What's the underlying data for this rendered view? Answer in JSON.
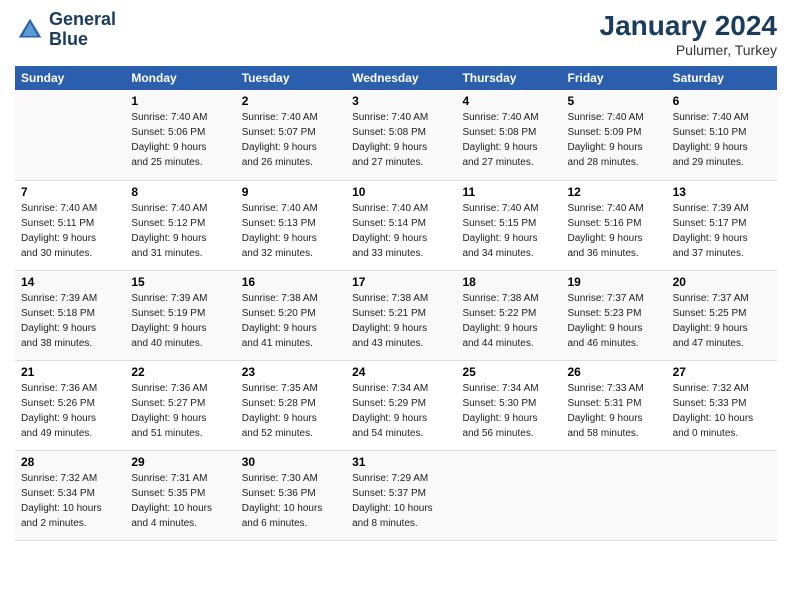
{
  "header": {
    "logo_line1": "General",
    "logo_line2": "Blue",
    "title": "January 2024",
    "subtitle": "Pulumer, Turkey"
  },
  "columns": [
    "Sunday",
    "Monday",
    "Tuesday",
    "Wednesday",
    "Thursday",
    "Friday",
    "Saturday"
  ],
  "weeks": [
    {
      "cells": [
        {
          "day": "",
          "info": ""
        },
        {
          "day": "1",
          "info": "Sunrise: 7:40 AM\nSunset: 5:06 PM\nDaylight: 9 hours\nand 25 minutes."
        },
        {
          "day": "2",
          "info": "Sunrise: 7:40 AM\nSunset: 5:07 PM\nDaylight: 9 hours\nand 26 minutes."
        },
        {
          "day": "3",
          "info": "Sunrise: 7:40 AM\nSunset: 5:08 PM\nDaylight: 9 hours\nand 27 minutes."
        },
        {
          "day": "4",
          "info": "Sunrise: 7:40 AM\nSunset: 5:08 PM\nDaylight: 9 hours\nand 27 minutes."
        },
        {
          "day": "5",
          "info": "Sunrise: 7:40 AM\nSunset: 5:09 PM\nDaylight: 9 hours\nand 28 minutes."
        },
        {
          "day": "6",
          "info": "Sunrise: 7:40 AM\nSunset: 5:10 PM\nDaylight: 9 hours\nand 29 minutes."
        }
      ]
    },
    {
      "cells": [
        {
          "day": "7",
          "info": "Sunrise: 7:40 AM\nSunset: 5:11 PM\nDaylight: 9 hours\nand 30 minutes."
        },
        {
          "day": "8",
          "info": "Sunrise: 7:40 AM\nSunset: 5:12 PM\nDaylight: 9 hours\nand 31 minutes."
        },
        {
          "day": "9",
          "info": "Sunrise: 7:40 AM\nSunset: 5:13 PM\nDaylight: 9 hours\nand 32 minutes."
        },
        {
          "day": "10",
          "info": "Sunrise: 7:40 AM\nSunset: 5:14 PM\nDaylight: 9 hours\nand 33 minutes."
        },
        {
          "day": "11",
          "info": "Sunrise: 7:40 AM\nSunset: 5:15 PM\nDaylight: 9 hours\nand 34 minutes."
        },
        {
          "day": "12",
          "info": "Sunrise: 7:40 AM\nSunset: 5:16 PM\nDaylight: 9 hours\nand 36 minutes."
        },
        {
          "day": "13",
          "info": "Sunrise: 7:39 AM\nSunset: 5:17 PM\nDaylight: 9 hours\nand 37 minutes."
        }
      ]
    },
    {
      "cells": [
        {
          "day": "14",
          "info": "Sunrise: 7:39 AM\nSunset: 5:18 PM\nDaylight: 9 hours\nand 38 minutes."
        },
        {
          "day": "15",
          "info": "Sunrise: 7:39 AM\nSunset: 5:19 PM\nDaylight: 9 hours\nand 40 minutes."
        },
        {
          "day": "16",
          "info": "Sunrise: 7:38 AM\nSunset: 5:20 PM\nDaylight: 9 hours\nand 41 minutes."
        },
        {
          "day": "17",
          "info": "Sunrise: 7:38 AM\nSunset: 5:21 PM\nDaylight: 9 hours\nand 43 minutes."
        },
        {
          "day": "18",
          "info": "Sunrise: 7:38 AM\nSunset: 5:22 PM\nDaylight: 9 hours\nand 44 minutes."
        },
        {
          "day": "19",
          "info": "Sunrise: 7:37 AM\nSunset: 5:23 PM\nDaylight: 9 hours\nand 46 minutes."
        },
        {
          "day": "20",
          "info": "Sunrise: 7:37 AM\nSunset: 5:25 PM\nDaylight: 9 hours\nand 47 minutes."
        }
      ]
    },
    {
      "cells": [
        {
          "day": "21",
          "info": "Sunrise: 7:36 AM\nSunset: 5:26 PM\nDaylight: 9 hours\nand 49 minutes."
        },
        {
          "day": "22",
          "info": "Sunrise: 7:36 AM\nSunset: 5:27 PM\nDaylight: 9 hours\nand 51 minutes."
        },
        {
          "day": "23",
          "info": "Sunrise: 7:35 AM\nSunset: 5:28 PM\nDaylight: 9 hours\nand 52 minutes."
        },
        {
          "day": "24",
          "info": "Sunrise: 7:34 AM\nSunset: 5:29 PM\nDaylight: 9 hours\nand 54 minutes."
        },
        {
          "day": "25",
          "info": "Sunrise: 7:34 AM\nSunset: 5:30 PM\nDaylight: 9 hours\nand 56 minutes."
        },
        {
          "day": "26",
          "info": "Sunrise: 7:33 AM\nSunset: 5:31 PM\nDaylight: 9 hours\nand 58 minutes."
        },
        {
          "day": "27",
          "info": "Sunrise: 7:32 AM\nSunset: 5:33 PM\nDaylight: 10 hours\nand 0 minutes."
        }
      ]
    },
    {
      "cells": [
        {
          "day": "28",
          "info": "Sunrise: 7:32 AM\nSunset: 5:34 PM\nDaylight: 10 hours\nand 2 minutes."
        },
        {
          "day": "29",
          "info": "Sunrise: 7:31 AM\nSunset: 5:35 PM\nDaylight: 10 hours\nand 4 minutes."
        },
        {
          "day": "30",
          "info": "Sunrise: 7:30 AM\nSunset: 5:36 PM\nDaylight: 10 hours\nand 6 minutes."
        },
        {
          "day": "31",
          "info": "Sunrise: 7:29 AM\nSunset: 5:37 PM\nDaylight: 10 hours\nand 8 minutes."
        },
        {
          "day": "",
          "info": ""
        },
        {
          "day": "",
          "info": ""
        },
        {
          "day": "",
          "info": ""
        }
      ]
    }
  ]
}
